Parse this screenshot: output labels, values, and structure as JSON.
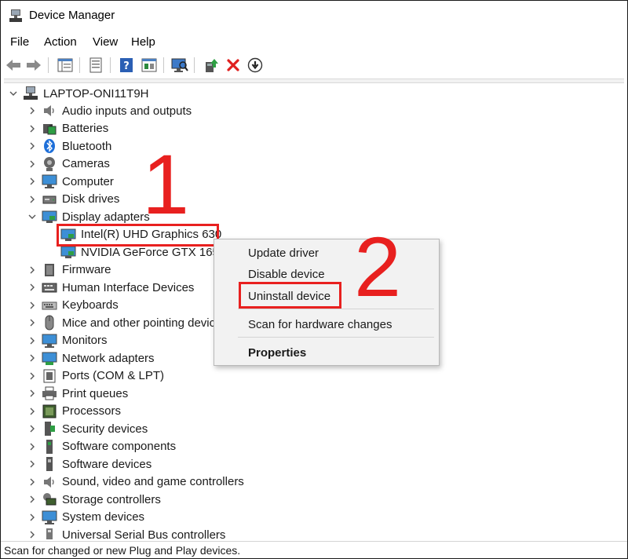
{
  "window": {
    "title": "Device Manager"
  },
  "menu": {
    "items": [
      "File",
      "Action",
      "View",
      "Help"
    ]
  },
  "toolbar": {
    "buttons": [
      "back-arrow-icon",
      "forward-arrow-icon",
      "tree-view-icon",
      "properties-icon",
      "help-icon",
      "resource-view-icon",
      "scan-monitor-icon",
      "update-driver-icon",
      "uninstall-x-icon",
      "download-circle-icon"
    ]
  },
  "tree": {
    "root": "LAPTOP-ONI11T9H",
    "categories": [
      "Audio inputs and outputs",
      "Batteries",
      "Bluetooth",
      "Cameras",
      "Computer",
      "Disk drives",
      "Display adapters",
      "Firmware",
      "Human Interface Devices",
      "Keyboards",
      "Mice and other pointing devices",
      "Monitors",
      "Network adapters",
      "Ports (COM & LPT)",
      "Print queues",
      "Processors",
      "Security devices",
      "Software components",
      "Software devices",
      "Sound, video and game controllers",
      "Storage controllers",
      "System devices",
      "Universal Serial Bus controllers"
    ],
    "display_children": [
      "Intel(R) UHD Graphics 630",
      "NVIDIA GeForce GTX 1650"
    ]
  },
  "context_menu": {
    "items": [
      "Update driver",
      "Disable device",
      "Uninstall device",
      "Scan for hardware changes",
      "Properties"
    ]
  },
  "annotations": {
    "step1": "1",
    "step2": "2"
  },
  "colors": {
    "highlight": "#e8201f",
    "menu_bg": "#f2f2f2"
  },
  "status": {
    "text": "Scan for changed or new Plug and Play devices."
  }
}
